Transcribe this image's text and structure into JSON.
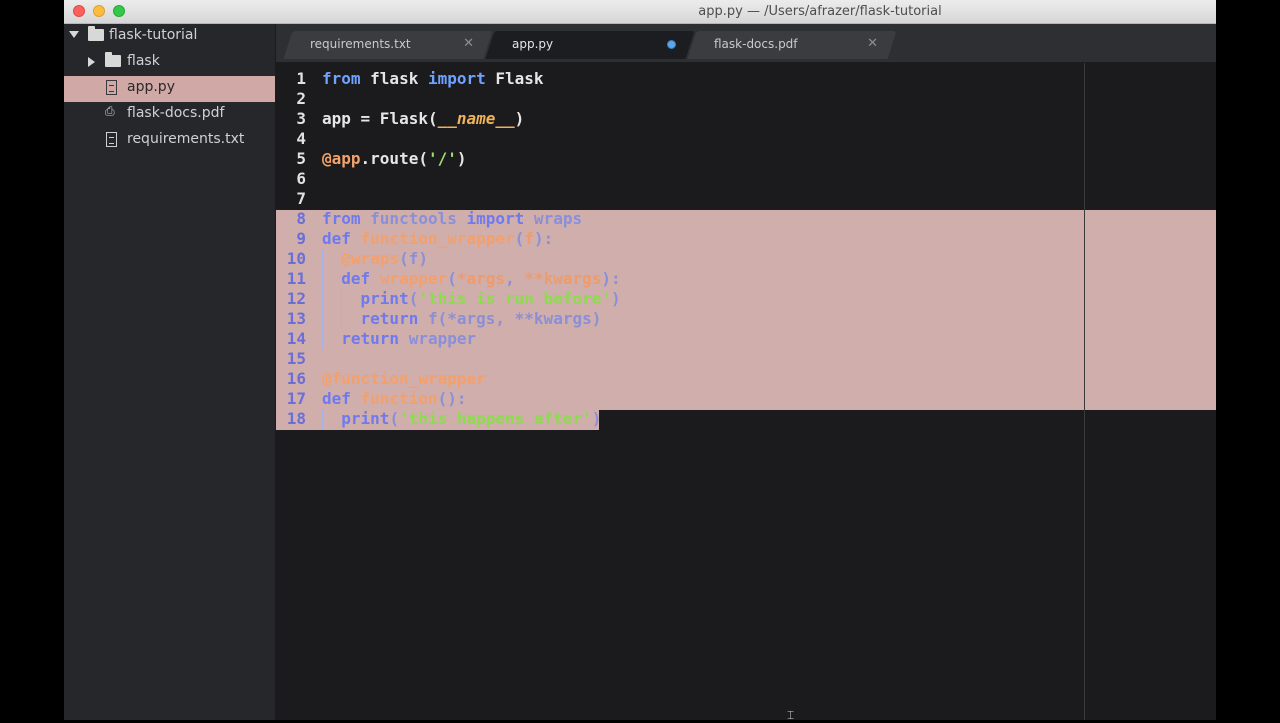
{
  "window": {
    "title": "app.py — /Users/afrazer/flask-tutorial"
  },
  "sidebar": {
    "root": "flask-tutorial",
    "items": [
      {
        "label": "flask",
        "kind": "folder"
      },
      {
        "label": "app.py",
        "kind": "file",
        "selected": true
      },
      {
        "label": "flask-docs.pdf",
        "kind": "pdf"
      },
      {
        "label": "requirements.txt",
        "kind": "file"
      }
    ]
  },
  "tabs": [
    {
      "label": "requirements.txt",
      "active": false
    },
    {
      "label": "app.py",
      "active": true,
      "dirty": true
    },
    {
      "label": "flask-docs.pdf",
      "active": false
    }
  ],
  "editor": {
    "lines": [
      {
        "n": "1",
        "tokens": [
          [
            "kw",
            "from"
          ],
          [
            "ident",
            " flask "
          ],
          [
            "kw",
            "import"
          ],
          [
            "ident",
            " Flask"
          ]
        ]
      },
      {
        "n": "2",
        "tokens": []
      },
      {
        "n": "3",
        "tokens": [
          [
            "ident",
            "app = Flask("
          ],
          [
            "dunder",
            "__name__"
          ],
          [
            "ident",
            ")"
          ]
        ]
      },
      {
        "n": "4",
        "tokens": []
      },
      {
        "n": "5",
        "tokens": [
          [
            "dec",
            "@app"
          ],
          [
            "ident",
            ".route("
          ],
          [
            "str",
            "'/'"
          ],
          [
            "ident",
            ")"
          ]
        ]
      },
      {
        "n": "6",
        "tokens": []
      },
      {
        "n": "7",
        "tokens": []
      },
      {
        "n": "8",
        "tokens": [
          [
            "kw",
            "from"
          ],
          [
            "ident",
            " functools "
          ],
          [
            "kw",
            "import"
          ],
          [
            "ident",
            " wraps"
          ]
        ]
      },
      {
        "n": "9",
        "tokens": [
          [
            "kw",
            "def"
          ],
          [
            "punct",
            " "
          ],
          [
            "fn",
            "function_wrapper"
          ],
          [
            "punct",
            "("
          ],
          [
            "arg",
            "f"
          ],
          [
            "punct",
            "):"
          ]
        ]
      },
      {
        "n": "10",
        "tokens": [
          [
            "punct",
            "  "
          ],
          [
            "dec",
            "@wraps"
          ],
          [
            "punct",
            "(f)"
          ]
        ]
      },
      {
        "n": "11",
        "tokens": [
          [
            "punct",
            "  "
          ],
          [
            "kw",
            "def"
          ],
          [
            "punct",
            " "
          ],
          [
            "fn",
            "wrapper"
          ],
          [
            "punct",
            "("
          ],
          [
            "arg",
            "*args"
          ],
          [
            "punct",
            ", "
          ],
          [
            "arg",
            "**kwargs"
          ],
          [
            "punct",
            "):"
          ]
        ]
      },
      {
        "n": "12",
        "tokens": [
          [
            "punct",
            "    "
          ],
          [
            "kw",
            "print"
          ],
          [
            "punct",
            "("
          ],
          [
            "str",
            "'this is run before'"
          ],
          [
            "punct",
            ")"
          ]
        ]
      },
      {
        "n": "13",
        "tokens": [
          [
            "punct",
            "    "
          ],
          [
            "kw",
            "return"
          ],
          [
            "punct",
            " f(*args, **kwargs)"
          ]
        ]
      },
      {
        "n": "14",
        "tokens": [
          [
            "punct",
            "  "
          ],
          [
            "kw",
            "return"
          ],
          [
            "punct",
            " wrapper"
          ]
        ]
      },
      {
        "n": "15",
        "tokens": []
      },
      {
        "n": "16",
        "tokens": [
          [
            "dec",
            "@function_wrapper"
          ]
        ]
      },
      {
        "n": "17",
        "tokens": [
          [
            "kw",
            "def"
          ],
          [
            "punct",
            " "
          ],
          [
            "fn",
            "function"
          ],
          [
            "punct",
            "():"
          ]
        ]
      },
      {
        "n": "18",
        "tokens": [
          [
            "punct",
            "  "
          ],
          [
            "kw",
            "print"
          ],
          [
            "punct",
            "("
          ],
          [
            "str",
            "'this happens after'"
          ],
          [
            "punct",
            ")"
          ]
        ]
      }
    ],
    "selection_start_line": 8,
    "selection_end_line": 18
  },
  "colors": {
    "selection": "#d0aeab",
    "sidebar_selected": "#d0a8a5",
    "keyword": "#6fa3ff",
    "string": "#9fe06f",
    "decorator": "#f2a36b"
  }
}
